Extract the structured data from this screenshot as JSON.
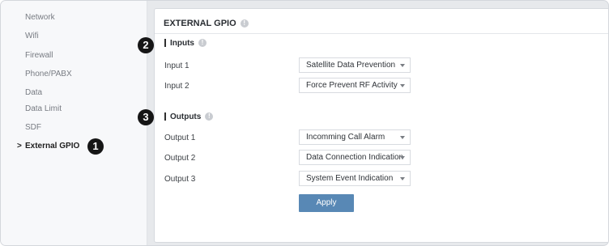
{
  "sidebar": {
    "items": [
      {
        "label": "Network"
      },
      {
        "label": "Wifi"
      },
      {
        "label": "Firewall"
      },
      {
        "label": "Phone/PABX"
      },
      {
        "label": "Data"
      },
      {
        "label": "Data Limit"
      },
      {
        "label": "SDF"
      },
      {
        "label": "External GPIO",
        "active": true
      }
    ],
    "chevron": ">"
  },
  "panel": {
    "title": "EXTERNAL GPIO",
    "info_glyph": "!"
  },
  "inputs": {
    "heading": "Inputs",
    "rows": [
      {
        "label": "Input 1",
        "value": "Satellite Data Prevention"
      },
      {
        "label": "Input 2",
        "value": "Force Prevent RF Activity"
      }
    ]
  },
  "outputs": {
    "heading": "Outputs",
    "rows": [
      {
        "label": "Output 1",
        "value": "Incomming Call Alarm"
      },
      {
        "label": "Output 2",
        "value": "Data Connection Indication"
      },
      {
        "label": "Output 3",
        "value": "System Event Indication"
      }
    ]
  },
  "apply_label": "Apply",
  "callouts": [
    "1",
    "2",
    "3"
  ],
  "colors": {
    "accent": "#5888b5",
    "callout": "#161616"
  }
}
